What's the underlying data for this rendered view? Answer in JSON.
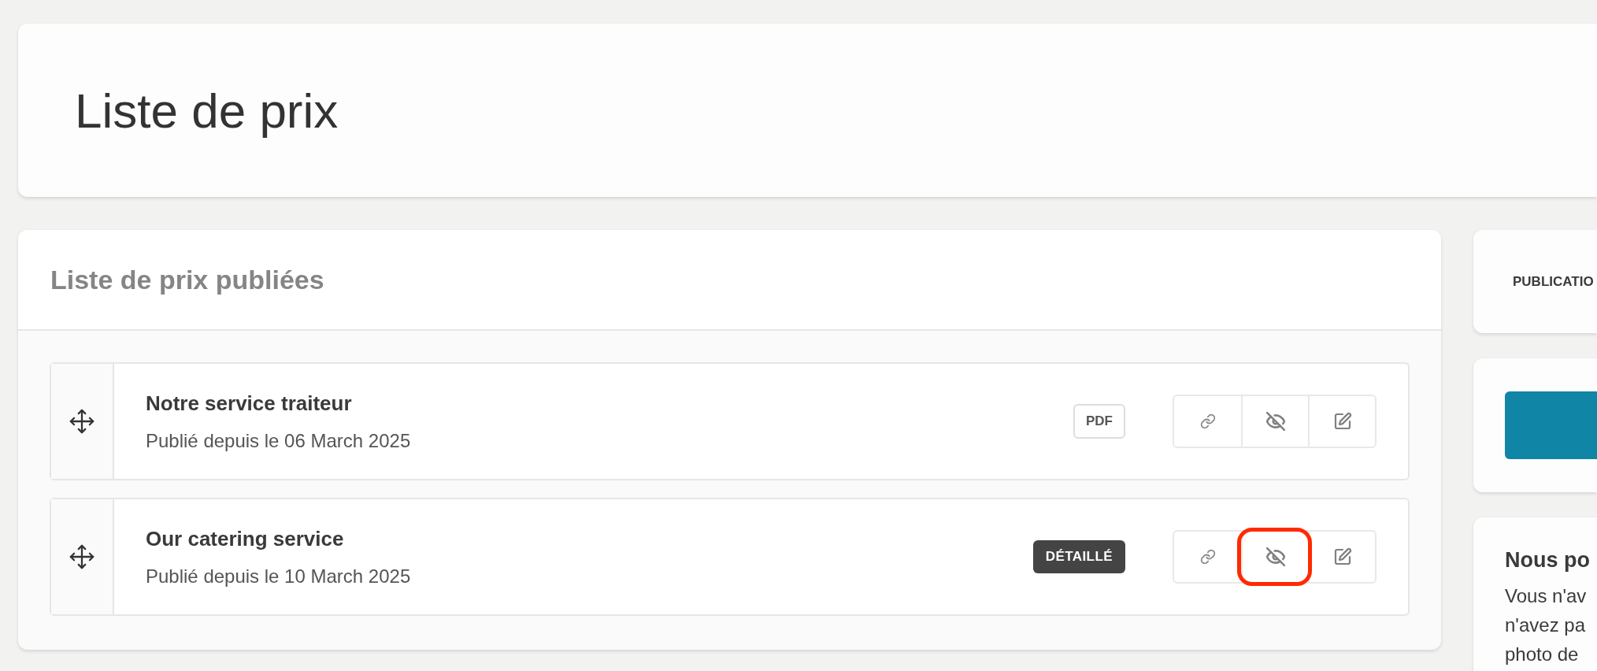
{
  "header": {
    "title": "Liste de prix"
  },
  "published": {
    "title": "Liste de prix publiées",
    "rows": [
      {
        "name": "Notre service traiteur",
        "date": "Publié depuis le 06 March 2025",
        "badge": {
          "label": "PDF",
          "kind": "outline"
        },
        "actions": [
          {
            "kind": "link",
            "highlighted": false
          },
          {
            "kind": "hide",
            "highlighted": false
          },
          {
            "kind": "edit",
            "highlighted": false
          }
        ]
      },
      {
        "name": "Our catering service",
        "date": "Publié depuis le 10 March 2025",
        "badge": {
          "label": "DÉTAILLÉ",
          "kind": "dark"
        },
        "actions": [
          {
            "kind": "link",
            "highlighted": false
          },
          {
            "kind": "hide",
            "highlighted": true
          },
          {
            "kind": "edit",
            "highlighted": false
          }
        ]
      }
    ]
  },
  "side": {
    "publication_label": "PUBLICATIO",
    "info": {
      "title": "Nous po",
      "lines": [
        "Vous n'av",
        "n'avez pa",
        "photo de"
      ]
    }
  }
}
